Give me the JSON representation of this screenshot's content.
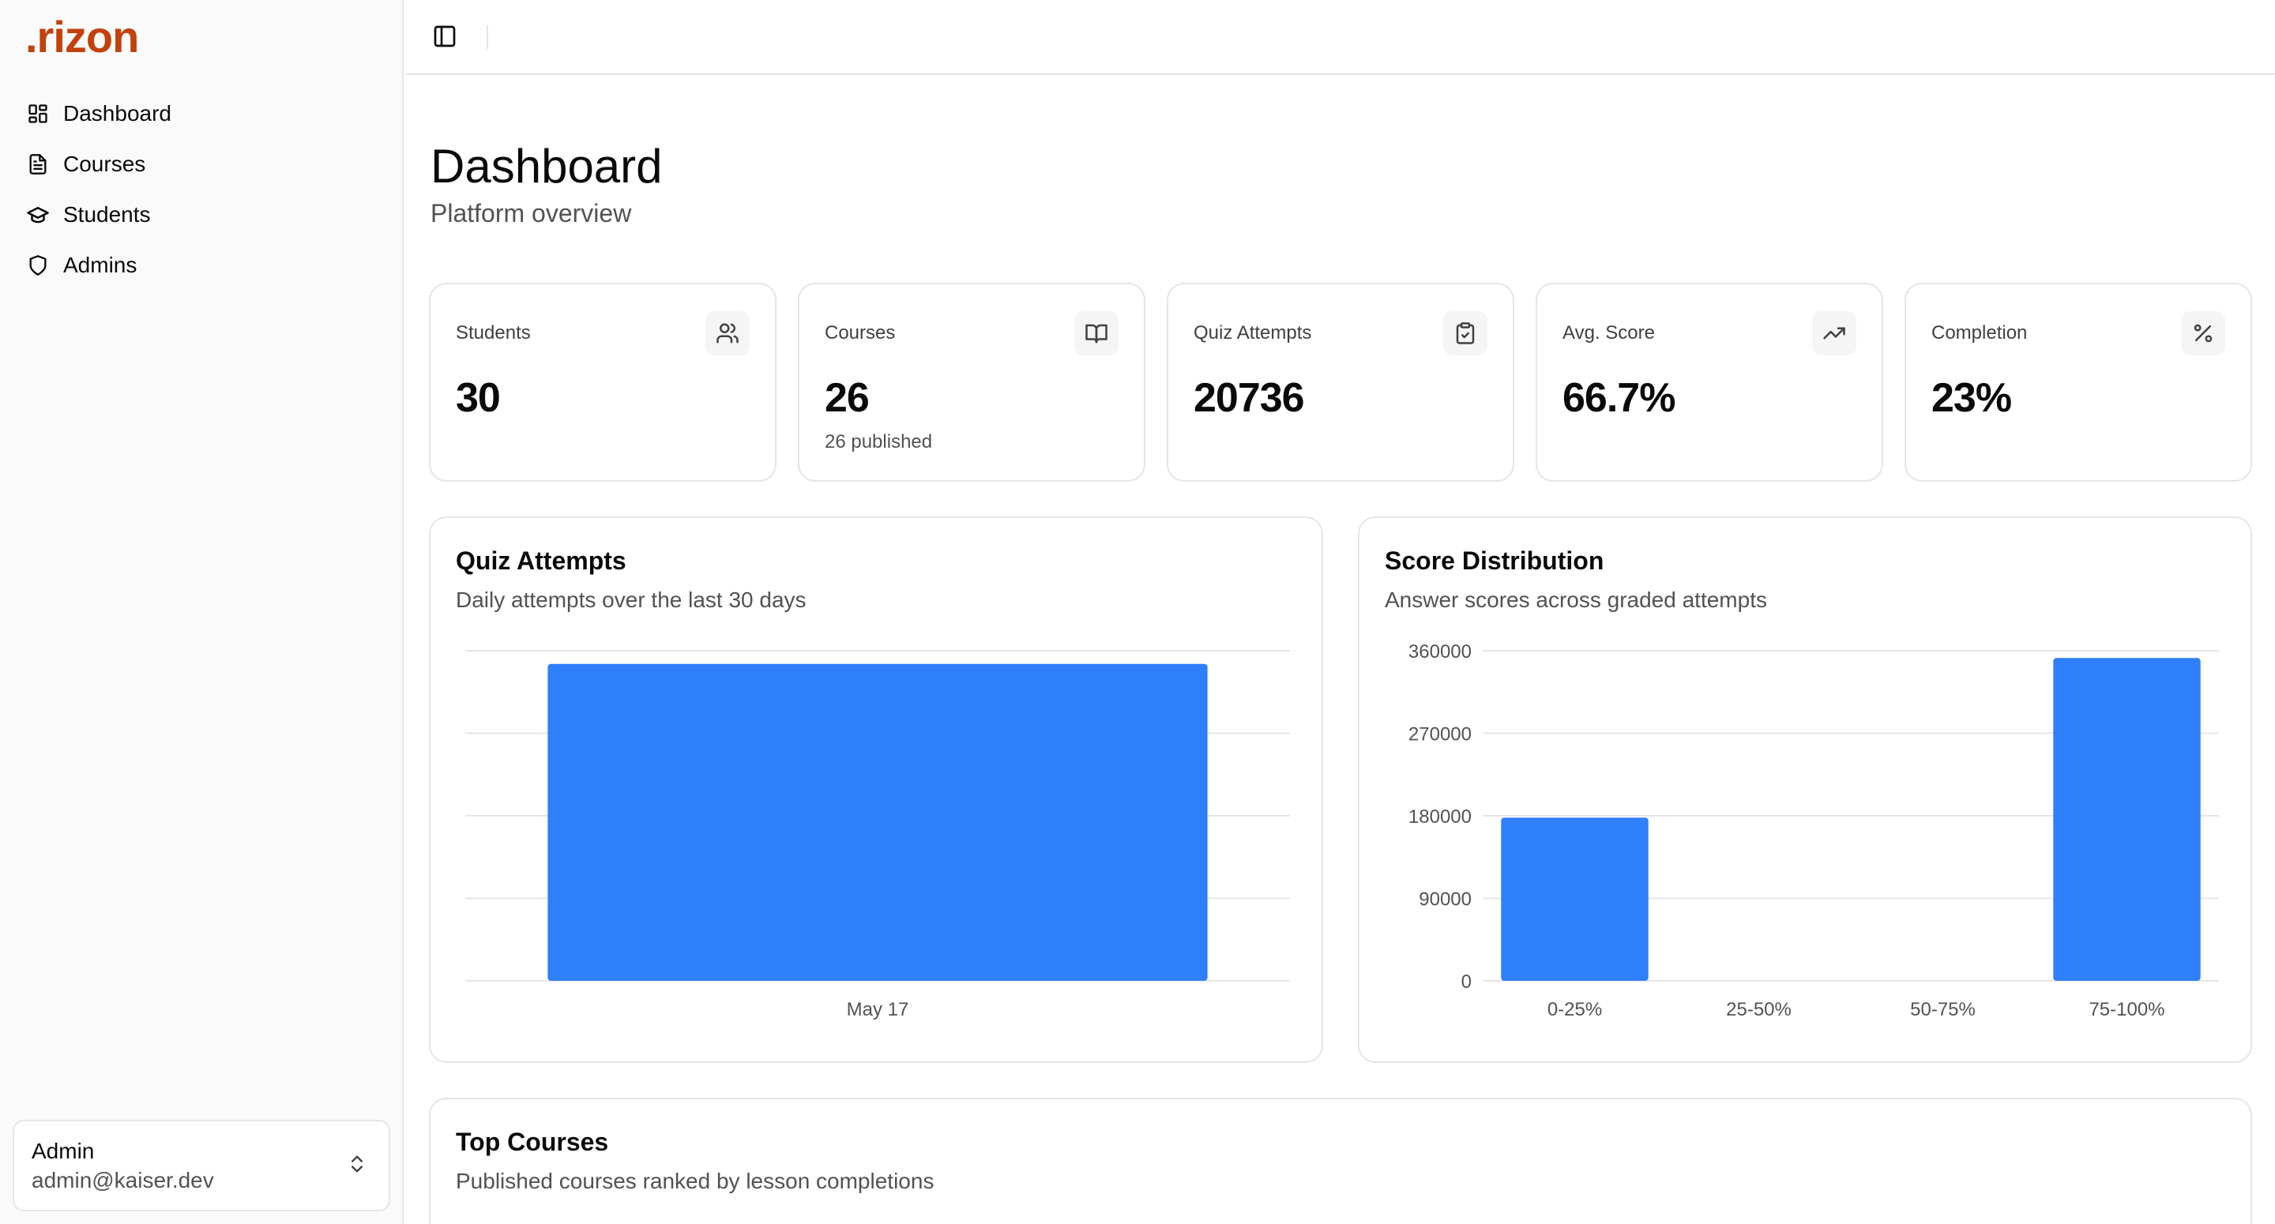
{
  "brand": {
    "logo": ".rizon",
    "color": "#c2410c"
  },
  "sidebar": {
    "items": [
      {
        "label": "Dashboard",
        "icon": "dashboard-icon"
      },
      {
        "label": "Courses",
        "icon": "document-icon"
      },
      {
        "label": "Students",
        "icon": "graduation-cap-icon"
      },
      {
        "label": "Admins",
        "icon": "shield-icon"
      }
    ],
    "user": {
      "name": "Admin",
      "email": "admin@kaiser.dev"
    }
  },
  "header": {
    "title": "Dashboard",
    "subtitle": "Platform overview"
  },
  "stats": [
    {
      "label": "Students",
      "value": "30",
      "sub": "",
      "icon": "users-icon"
    },
    {
      "label": "Courses",
      "value": "26",
      "sub": "26 published",
      "icon": "book-icon"
    },
    {
      "label": "Quiz Attempts",
      "value": "20736",
      "sub": "",
      "icon": "clipboard-check-icon"
    },
    {
      "label": "Avg. Score",
      "value": "66.7%",
      "sub": "",
      "icon": "trending-up-icon"
    },
    {
      "label": "Completion",
      "value": "23%",
      "sub": "",
      "icon": "percent-icon"
    }
  ],
  "quiz_card": {
    "title": "Quiz Attempts",
    "subtitle": "Daily attempts over the last 30 days"
  },
  "score_card": {
    "title": "Score Distribution",
    "subtitle": "Answer scores across graded attempts"
  },
  "top_courses": {
    "title": "Top Courses",
    "subtitle": "Published courses ranked by lesson completions"
  },
  "colors": {
    "bar": "#2f7ffb",
    "grid": "#e5e5e5",
    "axis_text": "#525252"
  },
  "chart_data": [
    {
      "type": "bar",
      "categories": [
        "May 17"
      ],
      "values": [
        20736
      ],
      "ylim": [
        0,
        21600
      ],
      "yticks_shown": false,
      "grid": true
    },
    {
      "type": "bar",
      "categories": [
        "0-25%",
        "25-50%",
        "50-75%",
        "75-100%"
      ],
      "values": [
        178000,
        0,
        0,
        352000
      ],
      "ylim": [
        0,
        360000
      ],
      "yticks": [
        0,
        90000,
        180000,
        270000,
        360000
      ],
      "grid": true
    }
  ]
}
